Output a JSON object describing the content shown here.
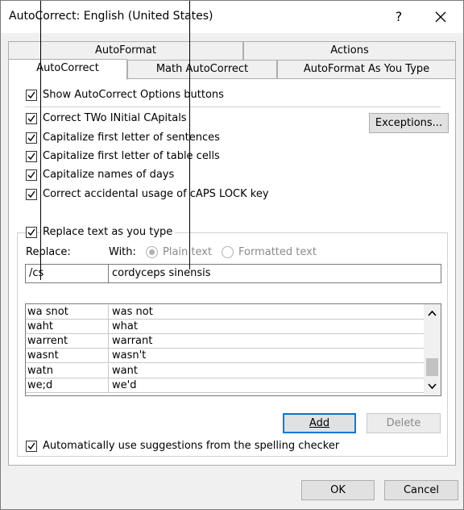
{
  "window": {
    "title": "AutoCorrect: English (United States)",
    "help_label": "?"
  },
  "tabs": {
    "row1": [
      {
        "label": "AutoFormat"
      },
      {
        "label": "Actions"
      }
    ],
    "row2": [
      {
        "label": "AutoCorrect"
      },
      {
        "label": "Math AutoCorrect"
      },
      {
        "label": "AutoFormat As You Type"
      }
    ]
  },
  "options": {
    "show_buttons": {
      "label": "Show AutoCorrect Options buttons",
      "checked": true
    },
    "two_initial_caps": {
      "label": "Correct TWo INitial CApitals",
      "checked": true
    },
    "first_letter_sentences": {
      "label": "Capitalize first letter of sentences",
      "checked": true
    },
    "first_letter_table": {
      "label": "Capitalize first letter of table cells",
      "checked": true
    },
    "names_of_days": {
      "label": "Capitalize names of days",
      "checked": true
    },
    "caps_lock": {
      "label": "Correct accidental usage of cAPS LOCK key",
      "checked": true
    },
    "exceptions_label": "Exceptions..."
  },
  "replace_section": {
    "replace_as_you_type": {
      "label": "Replace text as you type",
      "checked": true
    },
    "replace_label": "Replace:",
    "with_label": "With:",
    "plain_text_label": "Plain text",
    "formatted_text_label": "Formatted text",
    "replace_value": "/cs",
    "with_value": "cordyceps sinensis"
  },
  "entries": [
    {
      "from": "wa snot",
      "to": "was not"
    },
    {
      "from": "waht",
      "to": "what"
    },
    {
      "from": "warrent",
      "to": "warrant"
    },
    {
      "from": "wasnt",
      "to": "wasn't"
    },
    {
      "from": "watn",
      "to": "want"
    },
    {
      "from": "we;d",
      "to": "we'd"
    }
  ],
  "buttons": {
    "add": "Add",
    "delete": "Delete",
    "ok": "OK",
    "cancel": "Cancel"
  },
  "spelling_suggestions": {
    "label": "Automatically use suggestions from the spelling checker",
    "checked": true
  },
  "colors": {
    "accent": "#0078d7",
    "disabled_text": "#8a8a8a"
  }
}
